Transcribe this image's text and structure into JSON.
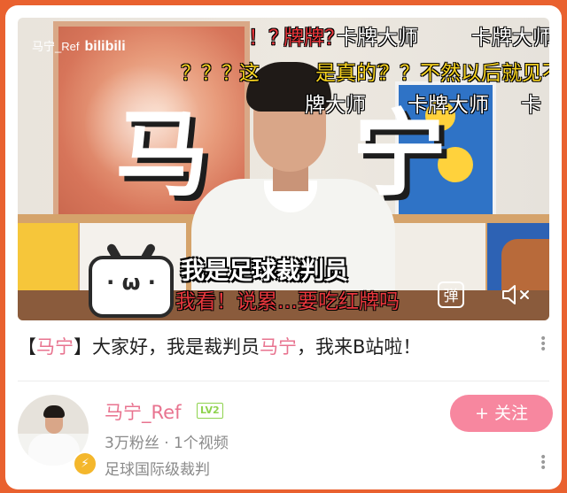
{
  "video": {
    "watermark_user": "马宁_Ref",
    "watermark_brand": "bilibili",
    "big_title_left": "马",
    "big_title_right": "宁",
    "subtitle": "我是足球裁判员",
    "danmaku": [
      {
        "text": "！？",
        "color": "red"
      },
      {
        "text": "牌牌？",
        "color": "red"
      },
      {
        "text": "卡牌大师",
        "color": "white"
      },
      {
        "text": "卡牌大师",
        "color": "white"
      },
      {
        "text": "？？？",
        "color": "yellow"
      },
      {
        "text": "这",
        "color": "yellow"
      },
      {
        "text": "是真的？",
        "color": "yellow"
      },
      {
        "text": "？？不然以后就见不",
        "color": "yellow"
      },
      {
        "text": "牌大师",
        "color": "white"
      },
      {
        "text": "卡牌大师",
        "color": "white"
      },
      {
        "text": "卡",
        "color": "white"
      },
      {
        "text": "我看！说累…要吃红牌吗",
        "color": "red"
      }
    ],
    "danmaku_button_label": "弹",
    "tv_face": "· ω ·"
  },
  "post": {
    "bracket_open": "【",
    "tag": "马宁",
    "bracket_close": "】",
    "text_a": "大家好，我是裁判员",
    "name": "马宁",
    "text_b": "，我来B站啦！"
  },
  "author": {
    "name": "马宁_Ref",
    "level": "LV2",
    "followers": "3万粉丝",
    "separator": "·",
    "videos": "1个视频",
    "description": "足球国际级裁判",
    "follow_label": "+ 关注"
  },
  "colors": {
    "background": "#e9612f",
    "accent_pink": "#e8738f",
    "follow_button": "#f7879f",
    "level_green": "#8fd34e"
  }
}
